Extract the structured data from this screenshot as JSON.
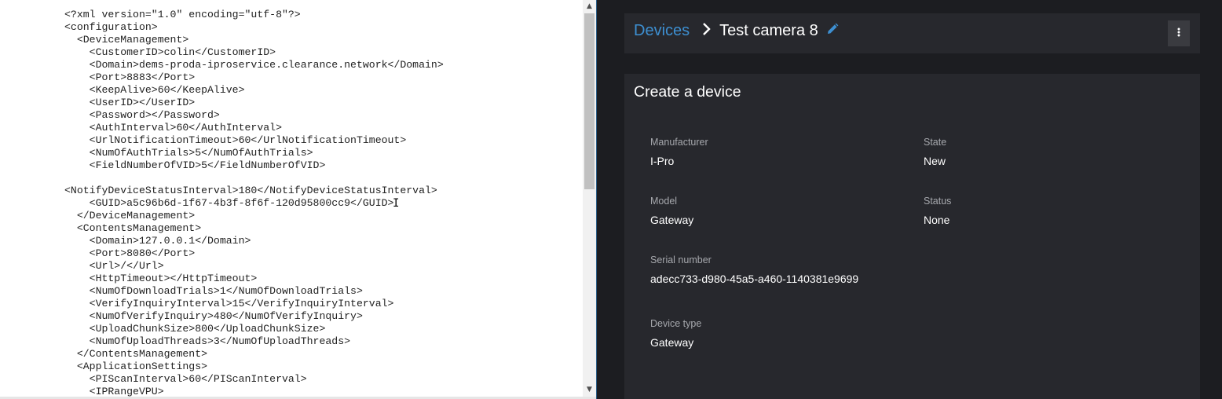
{
  "xml_editor": {
    "lines": [
      "<?xml version=\"1.0\" encoding=\"utf-8\"?>",
      "<configuration>",
      "  <DeviceManagement>",
      "    <CustomerID>colin</CustomerID>",
      "    <Domain>dems-proda-iproservice.clearance.network</Domain>",
      "    <Port>8883</Port>",
      "    <KeepAlive>60</KeepAlive>",
      "    <UserID></UserID>",
      "    <Password></Password>",
      "    <AuthInterval>60</AuthInterval>",
      "    <UrlNotificationTimeout>60</UrlNotificationTimeout>",
      "    <NumOfAuthTrials>5</NumOfAuthTrials>",
      "    <FieldNumberOfVID>5</FieldNumberOfVID>",
      "",
      "<NotifyDeviceStatusInterval>180</NotifyDeviceStatusInterval>",
      "    <GUID>a5c96b6d-1f67-4b3f-8f6f-120d95800cc9</GUID>",
      "  </DeviceManagement>",
      "  <ContentsManagement>",
      "    <Domain>127.0.0.1</Domain>",
      "    <Port>8080</Port>",
      "    <Url>/</Url>",
      "    <HttpTimeout></HttpTimeout>",
      "    <NumOfDownloadTrials>1</NumOfDownloadTrials>",
      "    <VerifyInquiryInterval>15</VerifyInquiryInterval>",
      "    <NumOfVerifyInquiry>480</NumOfVerifyInquiry>",
      "    <UploadChunkSize>800</UploadChunkSize>",
      "    <NumOfUploadThreads>3</NumOfUploadThreads>",
      "  </ContentsManagement>",
      "  <ApplicationSettings>",
      "    <PIScanInterval>60</PIScanInterval>",
      "    <IPRangeVPU>"
    ]
  },
  "breadcrumb": {
    "parent": "Devices",
    "separator_icon": "chevron-right-icon",
    "title": "Test camera 8",
    "edit_icon": "pencil-icon"
  },
  "menu_icon": "more-vertical-icon",
  "card": {
    "title": "Create a device",
    "fields": {
      "manufacturer": {
        "label": "Manufacturer",
        "value": "I-Pro"
      },
      "state": {
        "label": "State",
        "value": "New"
      },
      "model": {
        "label": "Model",
        "value": "Gateway"
      },
      "status": {
        "label": "Status",
        "value": "None"
      },
      "serial": {
        "label": "Serial number",
        "value": "adecc733-d980-45a5-a460-1140381e9699"
      },
      "device_type": {
        "label": "Device type",
        "value": "Gateway"
      }
    }
  },
  "colors": {
    "accent": "#3d8fd1",
    "app_background": "#1c1d21",
    "card_background": "#27282d"
  }
}
